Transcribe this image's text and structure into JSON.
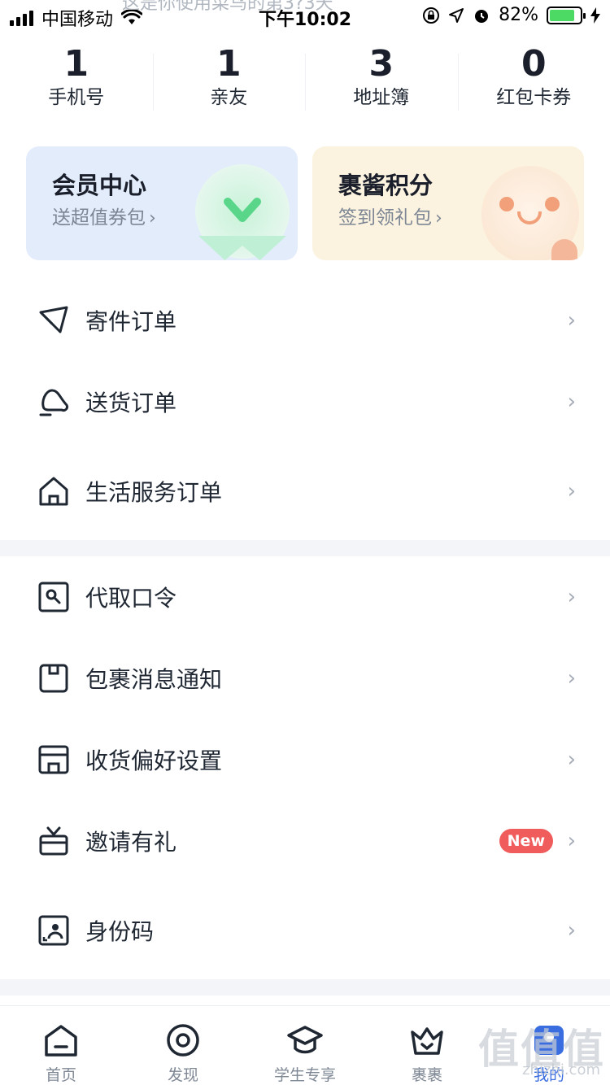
{
  "status_bar": {
    "carrier": "中国移动",
    "time": "下午10:02",
    "battery": "82%",
    "battery_level": 0.82
  },
  "ghost_header": "这是你使用菜鸟的第3?3天",
  "stats": [
    {
      "value": "1",
      "label": "手机号"
    },
    {
      "value": "1",
      "label": "亲友"
    },
    {
      "value": "3",
      "label": "地址簿"
    },
    {
      "value": "0",
      "label": "红包卡券"
    }
  ],
  "cards": {
    "member": {
      "title": "会员中心",
      "subtitle": "送超值券包",
      "arrow": "›"
    },
    "points": {
      "title": "裹酱积分",
      "subtitle": "签到领礼包",
      "arrow": "›"
    }
  },
  "menu_group_1": [
    {
      "label": "寄件订单",
      "icon": "paper-plane-icon"
    },
    {
      "label": "送货订单",
      "icon": "delivery-icon"
    },
    {
      "label": "生活服务订单",
      "icon": "home-icon"
    }
  ],
  "menu_group_2": [
    {
      "label": "代取口令",
      "icon": "key-card-icon"
    },
    {
      "label": "包裹消息通知",
      "icon": "package-icon"
    },
    {
      "label": "收货偏好设置",
      "icon": "store-icon"
    },
    {
      "label": "邀请有礼",
      "icon": "gift-icon",
      "badge": "New"
    },
    {
      "label": "身份码",
      "icon": "id-code-icon"
    }
  ],
  "chevron": "›",
  "tab_bar": [
    {
      "label": "首页",
      "icon": "home-tab-icon"
    },
    {
      "label": "发现",
      "icon": "discover-icon"
    },
    {
      "label": "学生专享",
      "icon": "graduation-cap-icon"
    },
    {
      "label": "裹裹",
      "icon": "crown-icon"
    },
    {
      "label": "我的",
      "icon": "profile-icon"
    }
  ],
  "watermark": {
    "text": "值值值",
    "sub": "zhizhi.com"
  },
  "colors": {
    "accent": "#3a6de0",
    "badge": "#f05b5b",
    "member_card": "#e3ecfb",
    "points_card": "#fbf3df"
  }
}
